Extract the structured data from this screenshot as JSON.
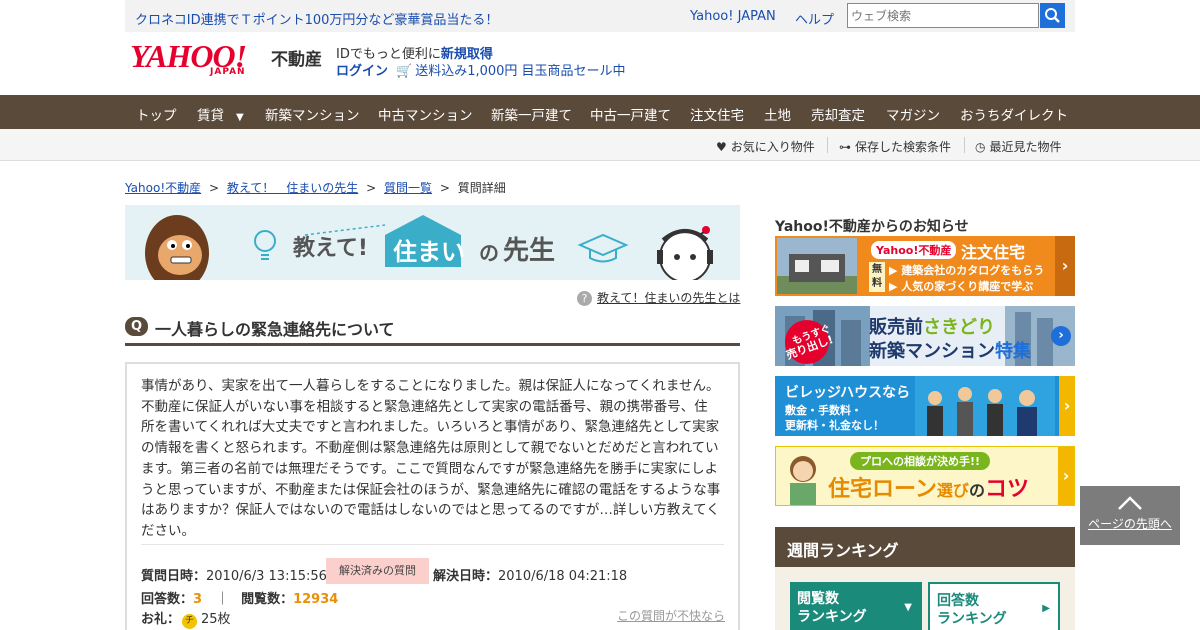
{
  "topbar": {
    "promo": "クロネコID連携でＴポイント100万円分など豪華賞品当たる！",
    "yahoo_japan": "Yahoo! JAPAN",
    "help": "ヘルプ",
    "search_placeholder": "ウェブ検索"
  },
  "header": {
    "logo_text": "YAHOO!",
    "logo_japan": "JAPAN",
    "logo_sub": "不動産",
    "id_text": "IDでもっと便利に",
    "id_link": "新規取得",
    "login": "ログイン",
    "shopping": "送料込み1,000円 目玉商品セール中"
  },
  "nav": {
    "items": [
      "トップ",
      "賃貸",
      "新築マンション",
      "中古マンション",
      "新築一戸建て",
      "中古一戸建て",
      "注文住宅",
      "土地",
      "売却査定",
      "マガジン",
      "おうちダイレクト"
    ]
  },
  "subnav": {
    "favorites": "お気に入り物件",
    "saved_search": "保存した検索条件",
    "recent": "最近見た物件"
  },
  "breadcrumb": {
    "home": "Yahoo!不動産",
    "sensei": "教えて！　住まいの先生",
    "list": "質問一覧",
    "current": "質問詳細",
    "sep": ">"
  },
  "banner": {
    "oshiete": "教えて!",
    "sumai": "住まい",
    "no": "の",
    "sensei": "先生"
  },
  "about_link": "教えて！住まいの先生とは",
  "question": {
    "badge": "Q",
    "title": "一人暮らしの緊急連絡先について",
    "body": "事情があり、実家を出て一人暮らしをすることになりました。親は保証人になってくれません。不動産に保証人がいない事を相談すると緊急連絡先として実家の電話番号、親の携帯番号、住所を書いてくれれば大丈夫ですと言われました。いろいろと事情があり、緊急連絡先として実家の情報を書くと怒られます。不動産側は緊急連絡先は原則として親でないとだめだと言われています。第三者の名前では無理だそうです。ここで質問なんですが緊急連絡先を勝手に実家にしようと思っていますが、不動産または保証会社のほうが、緊急連絡先に確認の電話をするような事はありますか？保証人ではないので電話はしないのではと思ってるのですが…詳しい方教えてください。",
    "asked_label": "質問日時：",
    "asked_at": "2010/6/3 13:15:56",
    "status": "解決済みの質問",
    "resolved_label": "解決日時：",
    "resolved_at": "2010/6/18 04:21:18",
    "answers_label": "回答数：",
    "answers": "3",
    "views_label": "閲覧数：",
    "views": "12934",
    "reward_label": "お礼：",
    "coin": "チ",
    "reward": "25枚",
    "report": "この質問が不快なら",
    "divider": "｜"
  },
  "sidebar": {
    "news_title": "Yahoo!不動産からのお知らせ",
    "ad1": {
      "tag": "Yahoo!不動産",
      "title": "注文住宅",
      "free1": "無",
      "free2": "料",
      "line1": "建築会社のカタログをもらう",
      "line2": "人気の家づくり講座で学ぶ"
    },
    "ad2": {
      "badge1": "もうすぐ",
      "badge2": "売り出し!",
      "line1a": "販売前",
      "line1b": "さきどり",
      "line2a": "新築マンション",
      "line2b": "特集"
    },
    "ad3": {
      "title": "ビレッジハウスなら",
      "line1": "敷金・手数料・",
      "line2": "更新料・礼金なし！"
    },
    "ad4": {
      "badge": "プロへの相談が決め手!!",
      "a": "住宅",
      "b": "ローン",
      "c": "選び",
      "d": "の",
      "e": "コツ"
    },
    "ranking_title": "週間ランキング",
    "tab1": "閲覧数ランキング",
    "tab1a": "閲覧数",
    "tab1b": "ランキング",
    "tab2a": "回答数",
    "tab2b": "ランキング"
  },
  "to_top": "ページの先頭へ",
  "colors": {
    "nav_bg": "#5a4a3a",
    "link": "#1a4dad",
    "accent_orange": "#e8900a",
    "yahoo_red": "#e6002d"
  }
}
